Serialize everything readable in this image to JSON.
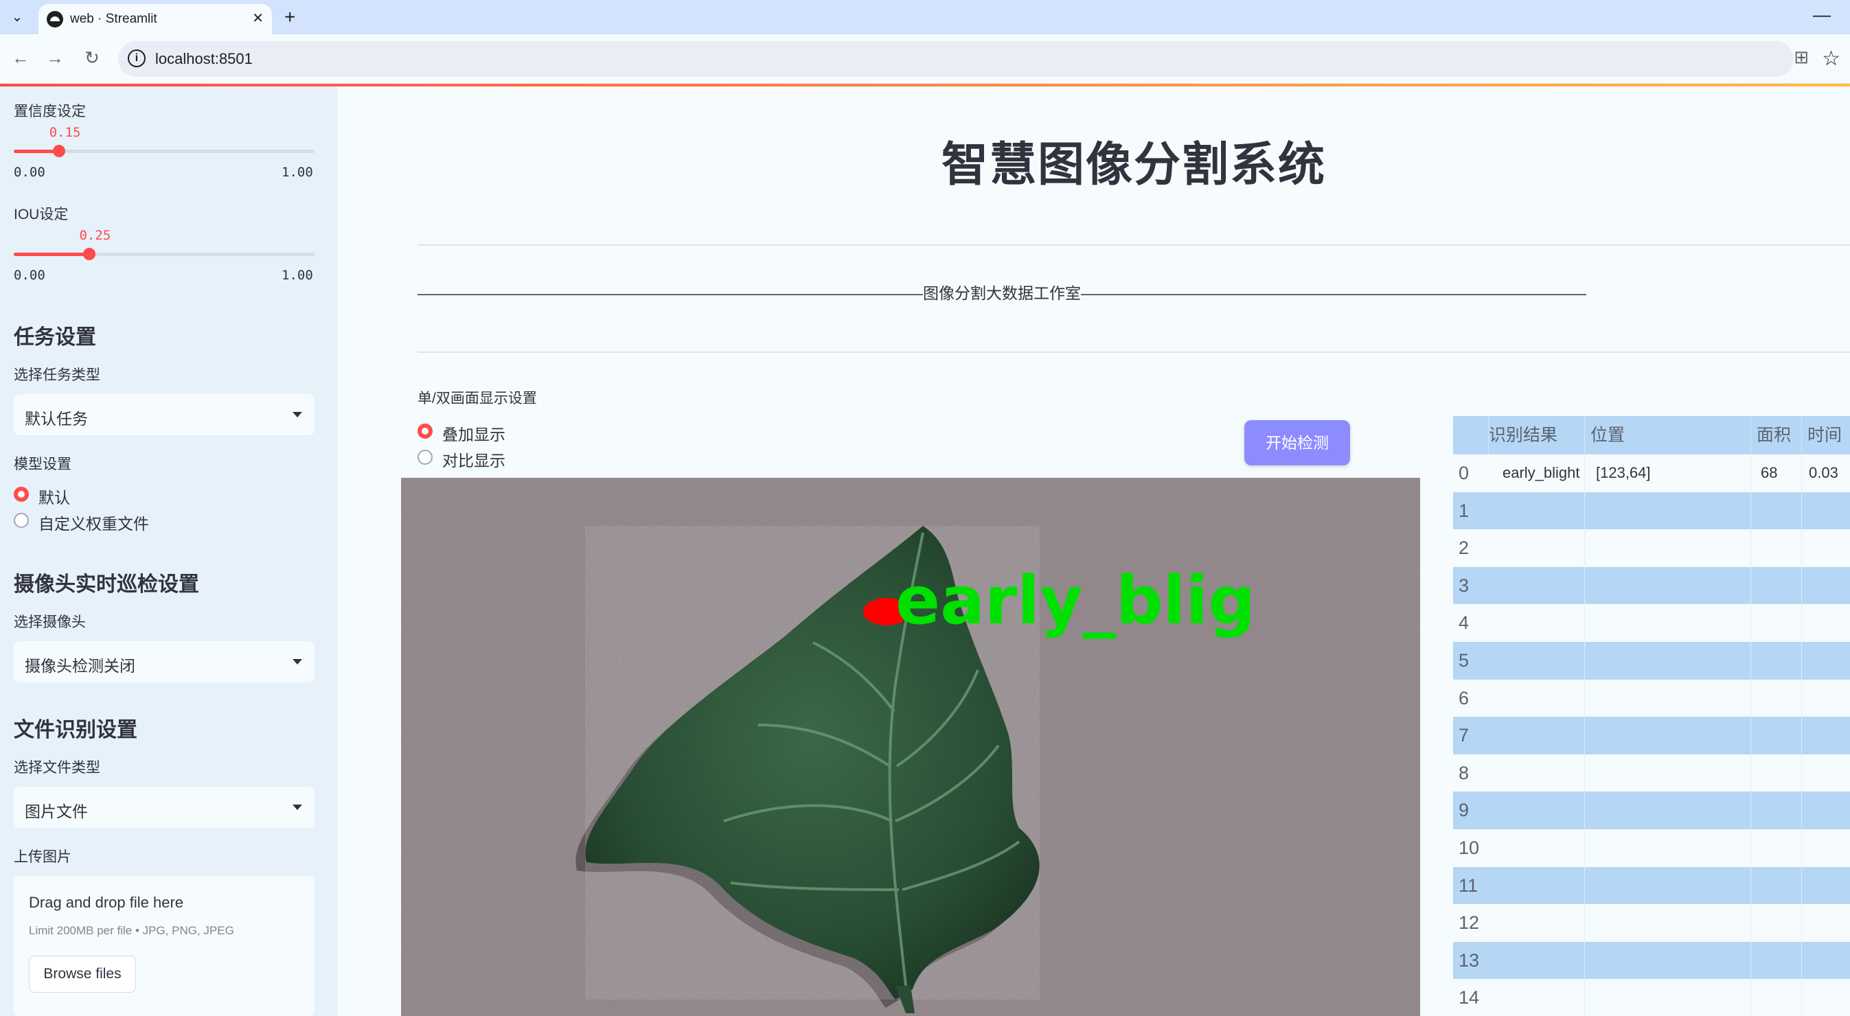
{
  "browser": {
    "tab_title": "web · Streamlit",
    "url": "localhost:8501"
  },
  "sidebar": {
    "confidence": {
      "label": "置信度设定",
      "value": "0.15",
      "level": 0.15,
      "min": "0.00",
      "max": "1.00"
    },
    "iou": {
      "label": "IOU设定",
      "value": "0.25",
      "level": 0.25,
      "min": "0.00",
      "max": "1.00"
    },
    "task_heading": "任务设置",
    "task_type_label": "选择任务类型",
    "task_type_value": "默认任务",
    "model_label": "模型设置",
    "model_options": [
      "默认",
      "自定义权重文件"
    ],
    "model_selected": 0,
    "camera_heading": "摄像头实时巡检设置",
    "camera_label": "选择摄像头",
    "camera_value": "摄像头检测关闭",
    "file_heading": "文件识别设置",
    "file_type_label": "选择文件类型",
    "file_type_value": "图片文件",
    "upload_label": "上传图片",
    "upload_title": "Drag and drop file here",
    "upload_hint": "Limit 200MB per file • JPG, PNG, JPEG",
    "browse_label": "Browse files"
  },
  "main": {
    "title": "智慧图像分割系统",
    "banner": "————————————————————————————————图像分割大数据工作室————————————————————————————————",
    "display_mode_label": "单/双画面显示设置",
    "display_options": [
      "叠加显示",
      "对比显示"
    ],
    "display_selected": 0,
    "detect_button": "开始检测",
    "detection_overlay_text": "early_blig"
  },
  "results_table": {
    "columns": [
      "",
      "识别结果",
      "位置",
      "面积",
      "时间"
    ],
    "rows": [
      {
        "index": "0",
        "result": "early_blight",
        "position": "[123,64]",
        "area": "68",
        "time": "0.03"
      },
      {
        "index": "1"
      },
      {
        "index": "2"
      },
      {
        "index": "3"
      },
      {
        "index": "4"
      },
      {
        "index": "5"
      },
      {
        "index": "6"
      },
      {
        "index": "7"
      },
      {
        "index": "8"
      },
      {
        "index": "9"
      },
      {
        "index": "10"
      },
      {
        "index": "11"
      },
      {
        "index": "12"
      },
      {
        "index": "13"
      },
      {
        "index": "14"
      }
    ]
  },
  "colors": {
    "accent": "#ff4b4b",
    "button": "#8c8cff",
    "table_stripe": "#b5d7f5",
    "sidebar_bg": "#e6f1fa",
    "overlay_text": "#00e000",
    "lesion": "#ff0000"
  }
}
